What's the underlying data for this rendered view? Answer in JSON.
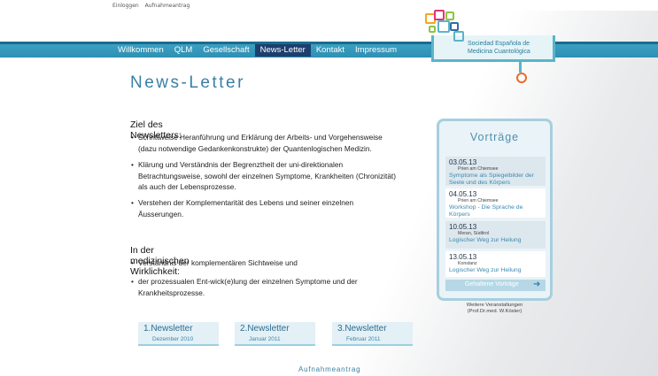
{
  "top_links": [
    "Einloggen",
    "Aufnahmeantrag"
  ],
  "nav": {
    "items": [
      "Willkommen",
      "QLM",
      "Gesellschaft",
      "News-Letter",
      "Kontakt",
      "Impressum"
    ],
    "active": "News-Letter"
  },
  "logo": {
    "line1": "Sociedad Española de",
    "line2": "Medicina Cuantológica",
    "colors": [
      "#f5a623",
      "#e2337b",
      "#5bb4c8",
      "#8cc63f",
      "#2d6da3",
      "#ea6c2c"
    ]
  },
  "page_title": "News-Letter",
  "section1": {
    "heading": "Ziel des Newsletters:",
    "bullets": [
      {
        "line1": "Schrittweise Heranführung und Erklärung der Arbeits- und Vorgehensweise",
        "line2": "(dazu notwendige Gedankenkonstrukte) der Quantenlogischen Medizin."
      },
      {
        "line1": "Klärung und Verständnis der Begrenztheit der uni-direktionalen",
        "line2": "Betrachtungsweise, sowohl der einzelnen Symptome, Krankheiten (Chronizität)",
        "line3": "als auch der Lebensprozesse."
      },
      {
        "line1": "Verstehen der Komplementarität des Lebens und seiner einzelnen",
        "line2": "Äusserungen."
      }
    ]
  },
  "section2": {
    "heading": "In der medizinischen Wirklichkeit:",
    "bullets": [
      {
        "line1": "Verständnis der komplementären Sichtweise und"
      },
      {
        "line1": "der prozessualen Ent-wick(e)lung der einzelnen Symptome und der",
        "line2": "Krankheitsprozesse."
      }
    ]
  },
  "newsletters": [
    {
      "title": "1.Newsletter",
      "date": "Dezember 2010"
    },
    {
      "title": "2.Newsletter",
      "date": "Januar 2011"
    },
    {
      "title": "3.Newsletter",
      "date": "Februar 2011"
    }
  ],
  "footer_link": "Aufnahmeantrag",
  "sidebar": {
    "title": "Vorträge",
    "events": [
      {
        "date": "03.05.13",
        "location": "Prien am Chiemsee",
        "title": "Symptome als Spiegelbilder der Seele und des Körpers"
      },
      {
        "date": "04.05.13",
        "location": "Prien am Chiemsee",
        "title": "Workshop - Die Sprache de Körpers"
      },
      {
        "date": "10.05.13",
        "location": "Meran, Südtirol",
        "title": "Logischer Weg zur Heilung"
      },
      {
        "date": "13.05.13",
        "location": "Konstanz",
        "title": "Logischer Weg zur Heilung"
      }
    ],
    "past_button": "Gehaltene Vorträge",
    "more_line1": "Weitere Veranstaltungen",
    "more_line2": "(Prof.Dr.med. W.Köster)"
  }
}
